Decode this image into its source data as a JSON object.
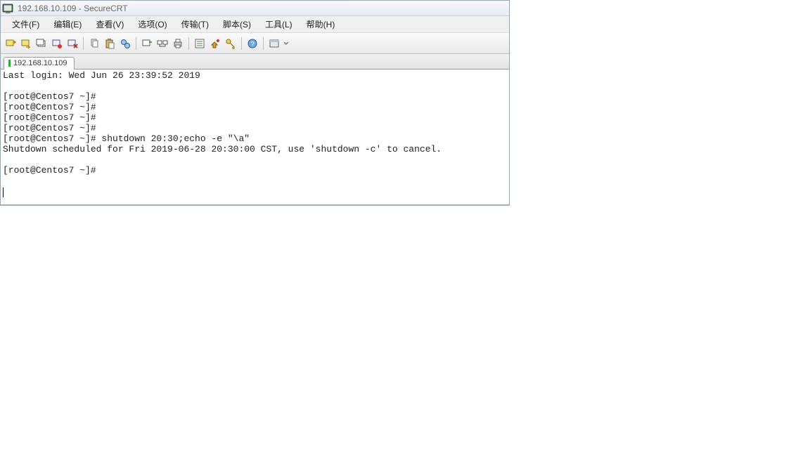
{
  "window": {
    "title": "192.168.10.109 - SecureCRT"
  },
  "menu": {
    "file": "文件(F)",
    "edit": "编辑(E)",
    "view": "查看(V)",
    "options": "选项(O)",
    "transfer": "传输(T)",
    "script": "脚本(S)",
    "tools": "工具(L)",
    "help": "帮助(H)"
  },
  "tab": {
    "label": "192.168.10.109"
  },
  "terminal": {
    "lines": [
      "Last login: Wed Jun 26 23:39:52 2019",
      "",
      "[root@Centos7 ~]# ",
      "[root@Centos7 ~]# ",
      "[root@Centos7 ~]# ",
      "[root@Centos7 ~]# ",
      "[root@Centos7 ~]# shutdown 20:30;echo -e \"\\a\"",
      "Shutdown scheduled for Fri 2019-06-28 20:30:00 CST, use 'shutdown -c' to cancel.",
      "",
      "[root@Centos7 ~]# "
    ]
  },
  "icons": {
    "app": "app-icon",
    "toolbar": [
      "quick-connect-icon",
      "reconnect-icon",
      "new-session-icon",
      "disconnect-icon",
      "cancel-icon",
      "sep",
      "copy-icon",
      "paste-icon",
      "find-icon",
      "sep",
      "sessions-icon",
      "hosts-icon",
      "print-icon",
      "sep",
      "settings-icon",
      "script-icon",
      "key-icon",
      "sep",
      "help-icon",
      "sep",
      "view-icon"
    ]
  }
}
